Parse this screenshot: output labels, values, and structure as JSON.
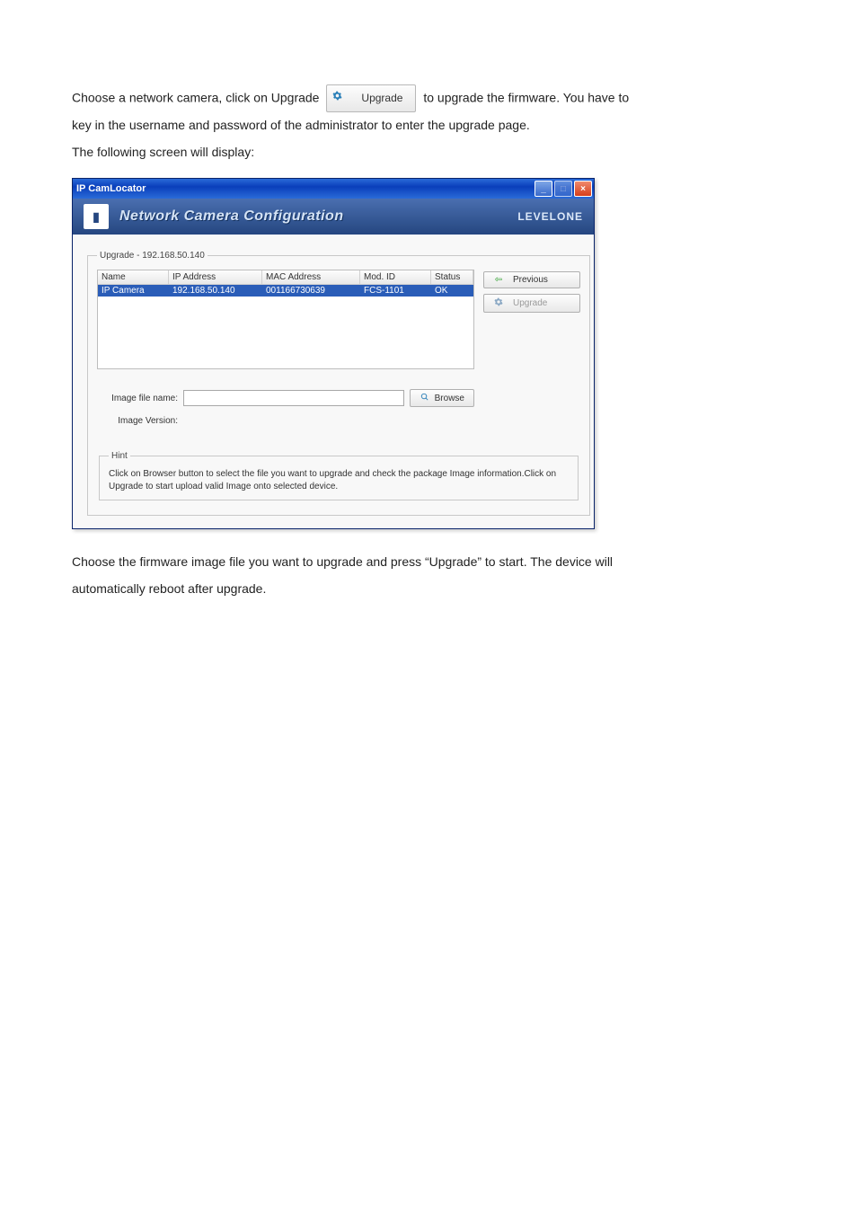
{
  "intro": {
    "line1_a": "Choose a network camera, click on Upgrade ",
    "line1_b": " to upgrade the firmware. You have to",
    "line2": "key in the username and password of the administrator to enter the upgrade page.",
    "line3": "The following screen will display:"
  },
  "inline_button": {
    "icon": "gear-icon",
    "label": "Upgrade"
  },
  "window": {
    "title": "IP CamLocator",
    "banner_title": "Network Camera Configuration",
    "brand": "LEVELONE",
    "groupbox_legend": "Upgrade - 192.168.50.140",
    "table": {
      "headers": [
        "Name",
        "IP Address",
        "MAC Address",
        "Mod. ID",
        "Status"
      ],
      "rows": [
        {
          "name": "IP Camera",
          "ip": "192.168.50.140",
          "mac": "001166730639",
          "mod": "FCS-1101",
          "status": "OK"
        }
      ]
    },
    "buttons": {
      "previous": "Previous",
      "upgrade": "Upgrade"
    },
    "fields": {
      "image_file_label": "Image file name:",
      "image_file_value": "",
      "browse": "Browse",
      "image_version_label": "Image Version:",
      "image_version_value": ""
    },
    "hint_legend": "Hint",
    "hint_text": "Click on Browser button to select the file you want to upgrade and check the package Image information.Click on Upgrade to start upload valid Image onto selected device."
  },
  "outro": {
    "line1": "Choose the firmware image file you want to upgrade and press “Upgrade” to start. The device will",
    "line2": "automatically reboot after upgrade."
  }
}
